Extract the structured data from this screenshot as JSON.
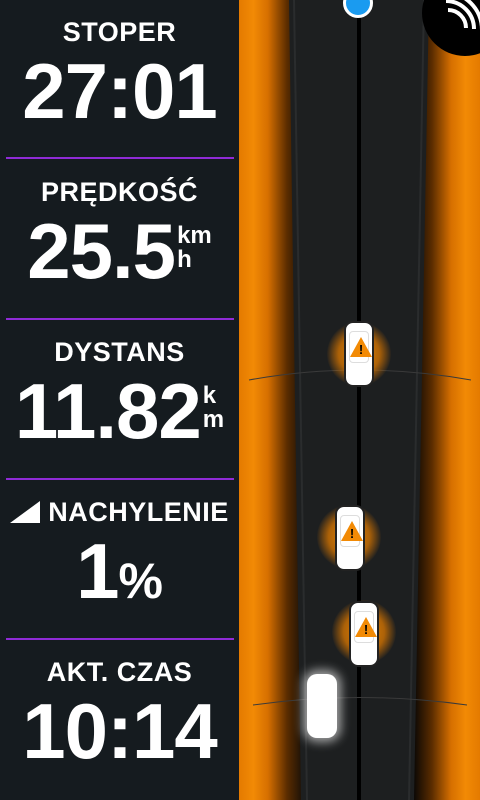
{
  "fields": [
    {
      "label": "STOPER",
      "value": "27:01"
    },
    {
      "label": "PRĘDKOŚĆ",
      "value": "25.5",
      "unit_top": "km",
      "unit_bottom": "h"
    },
    {
      "label": "DYSTANS",
      "value": "11.82",
      "unit_top": "k",
      "unit_bottom": "m"
    },
    {
      "label": "NACHYLENIE",
      "value": "1",
      "unit": "%"
    },
    {
      "label": "AKT. CZAS",
      "value": "10:14"
    }
  ],
  "map": {
    "warning_glyph": "!",
    "icons": [
      "rider-position-dot-icon",
      "sensor-signal-icon",
      "vehicle-warning-icon",
      "rider-icon"
    ]
  },
  "colors": {
    "panel_bg": "#151b1f",
    "divider": "#8f2bd6",
    "radar_orange": "#f28a05",
    "position_dot": "#1a9bf0"
  }
}
